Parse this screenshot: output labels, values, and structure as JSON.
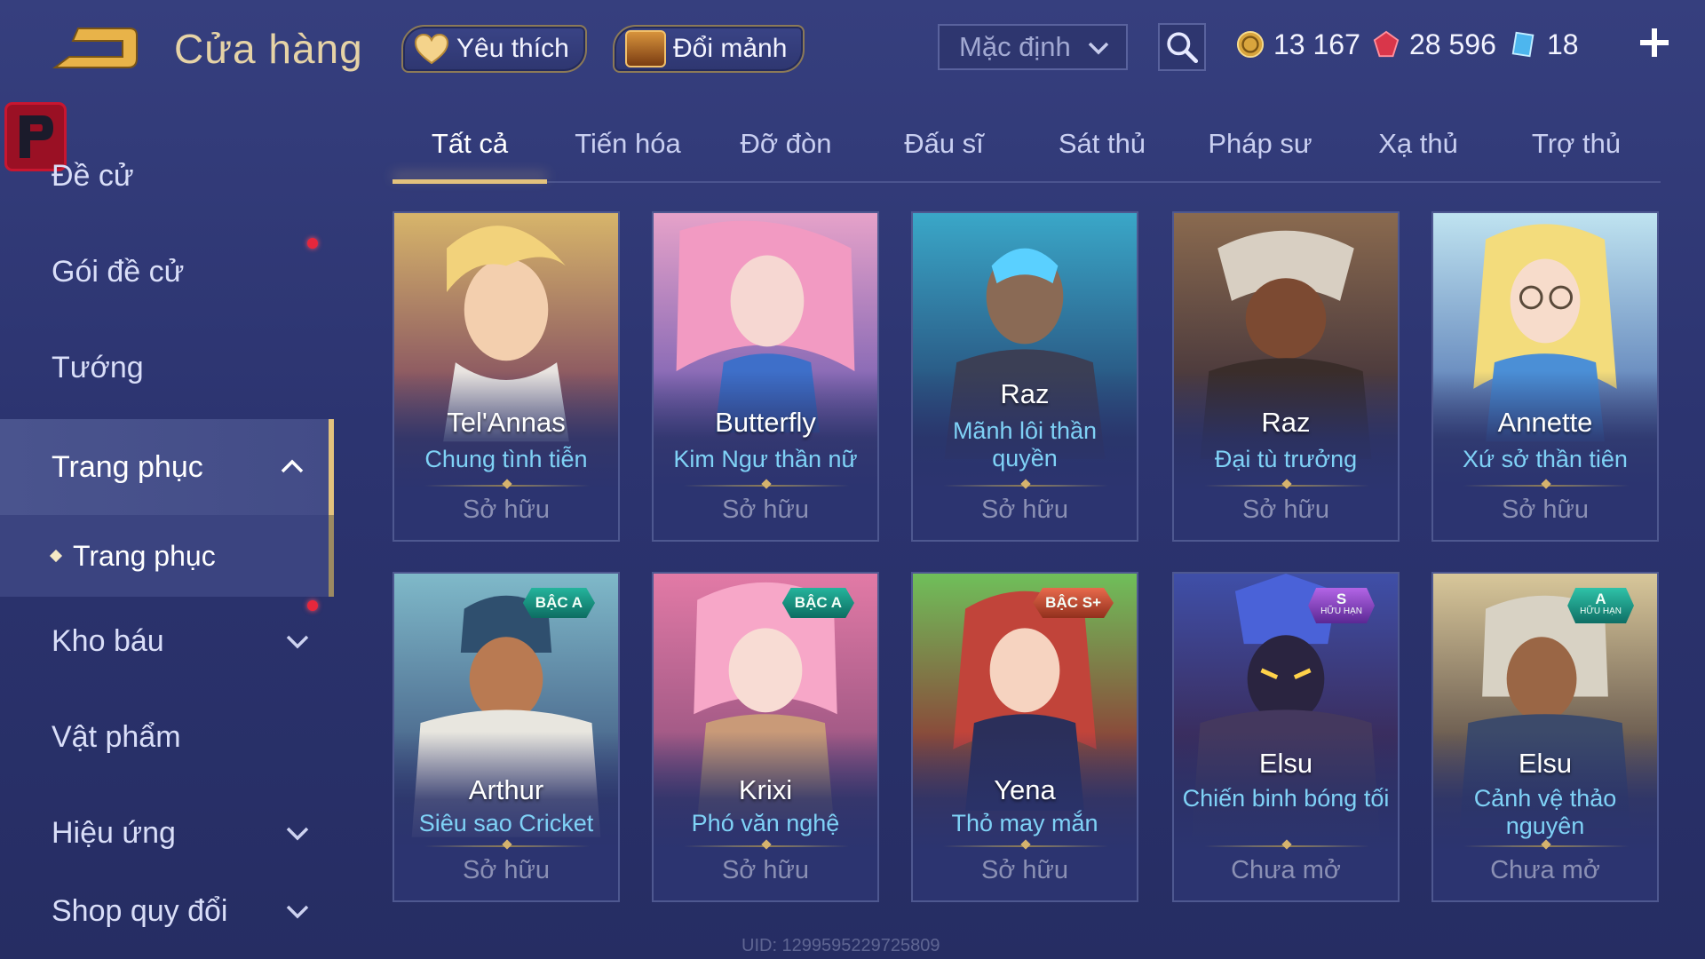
{
  "header": {
    "title": "Cửa hàng",
    "favorite_label": "Yêu thích",
    "fragment_label": "Đổi mảnh",
    "sort_value": "Mặc định",
    "gold": "13 167",
    "gems": "28 596",
    "coupons": "18"
  },
  "sidebar": {
    "items": [
      {
        "label": "Đề cử"
      },
      {
        "label": "Gói đề cử"
      },
      {
        "label": "Tướng"
      },
      {
        "label": "Trang phục"
      },
      {
        "label": "Kho báu"
      },
      {
        "label": "Vật phẩm"
      },
      {
        "label": "Hiệu ứng"
      },
      {
        "label": "Shop quy đổi"
      }
    ],
    "sub_label": "Trang phục"
  },
  "tabs": [
    {
      "label": "Tất cả"
    },
    {
      "label": "Tiến hóa"
    },
    {
      "label": "Đỡ đòn"
    },
    {
      "label": "Đấu sĩ"
    },
    {
      "label": "Sát thủ"
    },
    {
      "label": "Pháp sư"
    },
    {
      "label": "Xạ thủ"
    },
    {
      "label": "Trợ thủ"
    }
  ],
  "cards": [
    {
      "hero": "Tel'Annas",
      "skin": "Chung tình tiễn",
      "status": "Sở hữu",
      "badge": ""
    },
    {
      "hero": "Butterfly",
      "skin": "Kim Ngư thần nữ",
      "status": "Sở hữu",
      "badge": ""
    },
    {
      "hero": "Raz",
      "skin": "Mãnh lôi thần quyền",
      "status": "Sở hữu",
      "badge": ""
    },
    {
      "hero": "Raz",
      "skin": "Đại tù trưởng",
      "status": "Sở hữu",
      "badge": ""
    },
    {
      "hero": "Annette",
      "skin": "Xứ sở thần tiên",
      "status": "Sở hữu",
      "badge": ""
    },
    {
      "hero": "Arthur",
      "skin": "Siêu sao Cricket",
      "status": "Sở hữu",
      "badge": "BẬC A"
    },
    {
      "hero": "Krixi",
      "skin": "Phó văn nghệ",
      "status": "Sở hữu",
      "badge": "BẬC A"
    },
    {
      "hero": "Yena",
      "skin": "Thỏ may mắn",
      "status": "Sở hữu",
      "badge": "BẬC S+"
    },
    {
      "hero": "Elsu",
      "skin": "Chiến binh bóng tối",
      "status": "Chưa mở",
      "badge": "S",
      "badge_sub": "HỮU HẠN"
    },
    {
      "hero": "Elsu",
      "skin": "Cảnh vệ thảo nguyên",
      "status": "Chưa mở",
      "badge": "A",
      "badge_sub": "HỮU HẠN"
    }
  ],
  "footer": {
    "uid": "UID: 1299595229725809"
  },
  "colors": {
    "gold_accent": "#e3c27d",
    "skin_name": "#7fd2f6",
    "background": "#2c3470"
  }
}
